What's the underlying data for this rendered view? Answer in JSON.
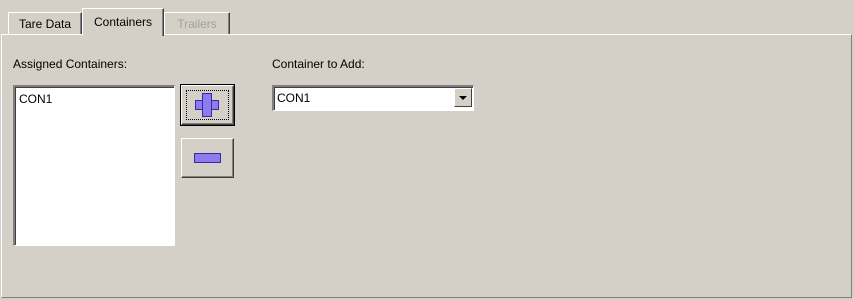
{
  "tabs": [
    {
      "label": "Tare Data",
      "state": "inactive"
    },
    {
      "label": "Containers",
      "state": "active"
    },
    {
      "label": "Trailers",
      "state": "disabled"
    }
  ],
  "assigned": {
    "label": "Assigned Containers:",
    "items": [
      "CON1"
    ]
  },
  "container_to_add": {
    "label": "Container to Add:",
    "selected": "CON1"
  },
  "buttons": {
    "add_icon": "plus-icon",
    "remove_icon": "minus-icon"
  },
  "colors": {
    "background": "#d4d0c8",
    "icon_fill": "#8c7cf0",
    "disabled_text": "#a0a0a0"
  }
}
